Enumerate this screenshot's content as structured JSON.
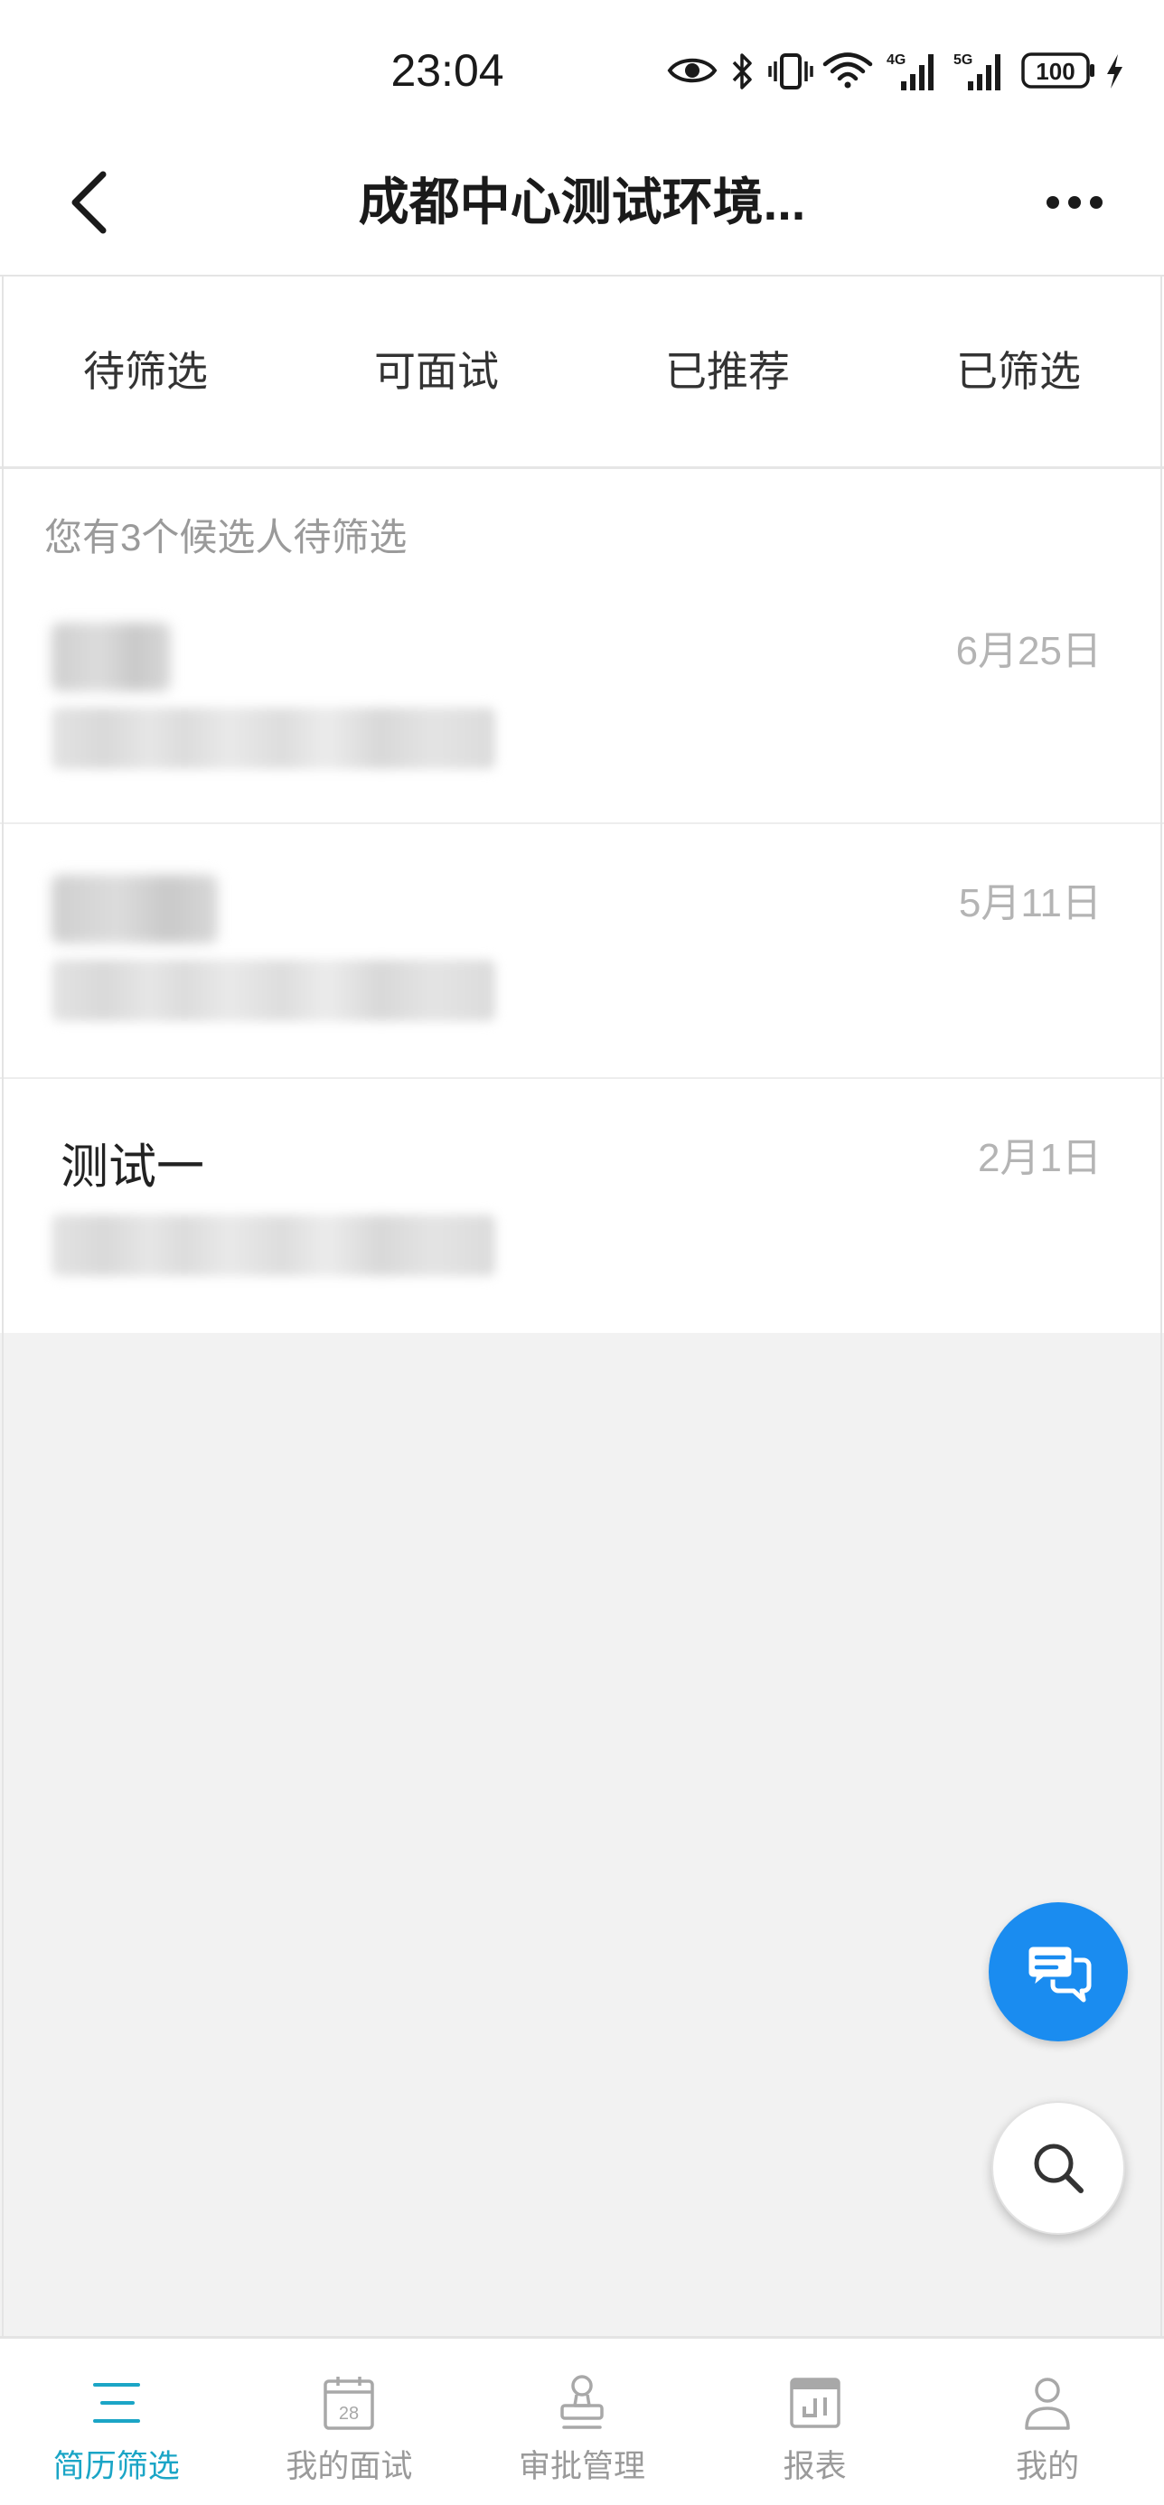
{
  "status_bar": {
    "time": "23:04",
    "icons": [
      "eye-icon",
      "bluetooth-icon",
      "vibrate-icon",
      "wifi-icon",
      "signal-4g-icon",
      "signal-5g-icon",
      "battery-icon",
      "charging-icon"
    ],
    "network_1": "4G",
    "network_2": "5G",
    "battery_level": "100"
  },
  "header": {
    "back_icon": "chevron-left-icon",
    "title": "成都中心测试环境...",
    "more_icon": "more-dots-icon"
  },
  "tabs": [
    {
      "label": "待筛选"
    },
    {
      "label": "可面试"
    },
    {
      "label": "已推荐"
    },
    {
      "label": "已筛选"
    }
  ],
  "list": {
    "hint": "您有3个候选人待筛选",
    "candidates": [
      {
        "name_obscured": true,
        "detail_obscured": true,
        "date": "6月25日"
      },
      {
        "name_obscured": true,
        "detail_obscured": true,
        "date": "5月11日"
      },
      {
        "name": "测试一",
        "detail_obscured": true,
        "date": "2月1日"
      }
    ]
  },
  "fab": {
    "chat_icon": "chat-bubbles-icon",
    "search_icon": "search-icon"
  },
  "bottom_nav": {
    "active_index": 0,
    "items": [
      {
        "label": "简历筛选",
        "icon": "list-icon"
      },
      {
        "label": "我的面试",
        "icon": "calendar-icon",
        "icon_text": "28"
      },
      {
        "label": "审批管理",
        "icon": "stamp-icon"
      },
      {
        "label": "报表",
        "icon": "report-icon"
      },
      {
        "label": "我的",
        "icon": "person-icon"
      }
    ]
  },
  "colors": {
    "accent": "#1ba5c6",
    "fab_blue": "#1a8cf0",
    "inactive": "#a8a8a8",
    "date_gray": "#b4b4b4",
    "hint_gray": "#9a9a9a",
    "background_gray": "#f2f2f2"
  }
}
